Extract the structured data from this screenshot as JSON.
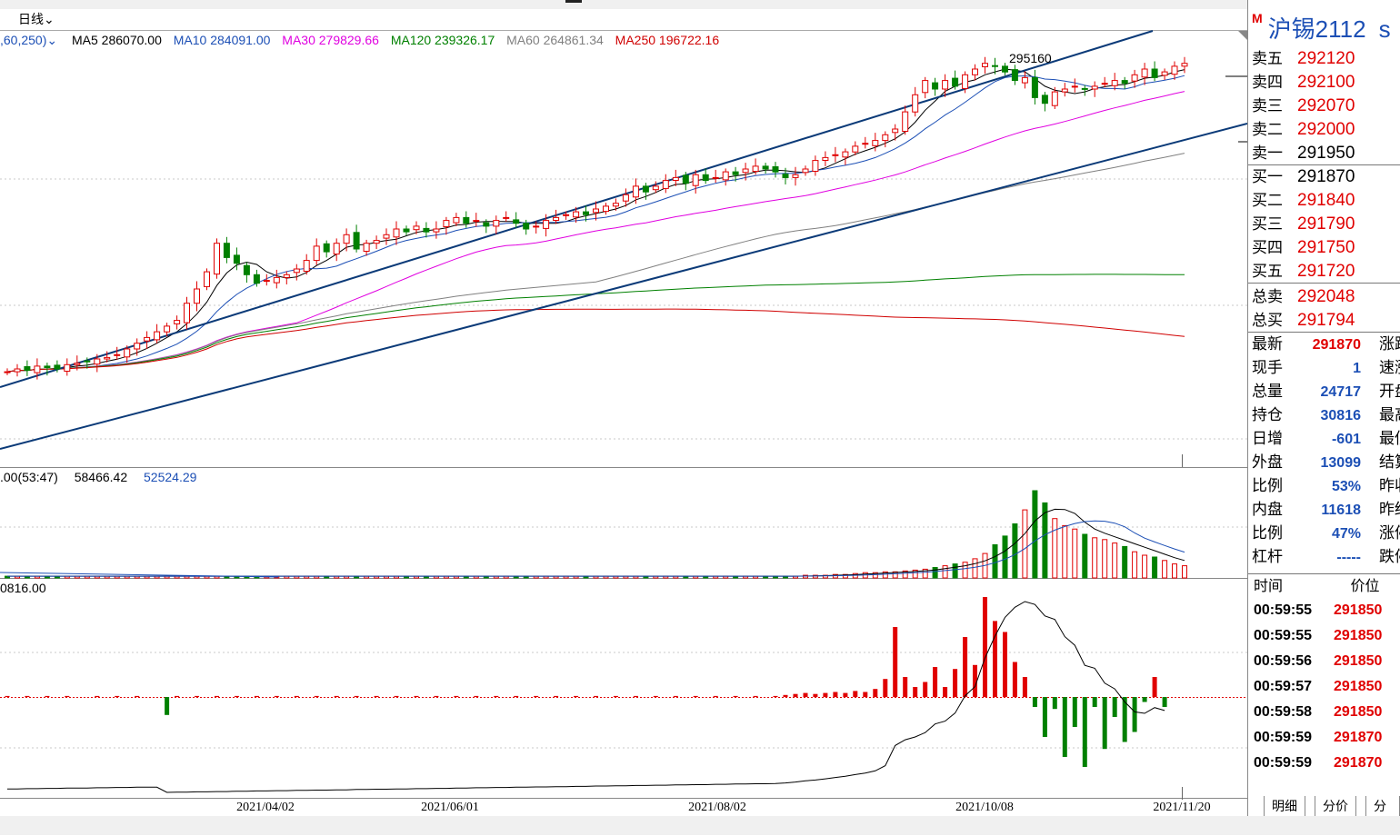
{
  "toolbar": {
    "period_label": "日线"
  },
  "ma_legend": [
    {
      "text": ",60,250)",
      "color": "#1c4fb5"
    },
    {
      "text": "MA5 286070.00",
      "color": "#000000"
    },
    {
      "text": "MA10 284091.00",
      "color": "#1c4fb5"
    },
    {
      "text": "MA30 279829.66",
      "color": "#e000e0"
    },
    {
      "text": "MA120 239326.17",
      "color": "#008000"
    },
    {
      "text": "MA60 264861.34",
      "color": "#808080"
    },
    {
      "text": "MA250 196722.16",
      "color": "#d00000"
    }
  ],
  "chart": {
    "high_label": "295160"
  },
  "vol_legend": [
    {
      "text": ".00(53:47)",
      "color": "#000000"
    },
    {
      "text": "58466.42",
      "color": "#000000"
    },
    {
      "text": "52524.29",
      "color": "#1c4fb5"
    }
  ],
  "oi_legend": {
    "text": "0816.00"
  },
  "dates": [
    "2021/04/02",
    "2021/06/01",
    "2021/08/02",
    "2021/10/08",
    "2021/11/20"
  ],
  "panel": {
    "marker": "M",
    "title": "沪锡2112",
    "title_tail": "s",
    "asks": [
      {
        "label": "卖五",
        "price": "292120"
      },
      {
        "label": "卖四",
        "price": "292100"
      },
      {
        "label": "卖三",
        "price": "292070"
      },
      {
        "label": "卖二",
        "price": "292000"
      },
      {
        "label": "卖一",
        "price": "291950"
      }
    ],
    "bids": [
      {
        "label": "买一",
        "price": "291870"
      },
      {
        "label": "买二",
        "price": "291840"
      },
      {
        "label": "买三",
        "price": "291790"
      },
      {
        "label": "买四",
        "price": "291750"
      },
      {
        "label": "买五",
        "price": "291720"
      }
    ],
    "totals": [
      {
        "label": "总卖",
        "value": "292048"
      },
      {
        "label": "总买",
        "value": "291794"
      }
    ],
    "stats": [
      {
        "label": "最新",
        "value": "291870",
        "red": true,
        "label2": "涨跌"
      },
      {
        "label": "现手",
        "value": "1",
        "red": false,
        "label2": "速涨"
      },
      {
        "label": "总量",
        "value": "24717",
        "red": false,
        "label2": "开盘"
      },
      {
        "label": "持仓",
        "value": "30816",
        "red": false,
        "label2": "最高"
      },
      {
        "label": "日增",
        "value": "-601",
        "red": false,
        "label2": "最低"
      },
      {
        "label": "外盘",
        "value": "13099",
        "red": false,
        "label2": "结算"
      },
      {
        "label": "比例",
        "value": "53%",
        "red": false,
        "label2": "昨收"
      },
      {
        "label": "内盘",
        "value": "11618",
        "red": false,
        "label2": "昨结"
      },
      {
        "label": "比例",
        "value": "47%",
        "red": false,
        "label2": "涨停"
      },
      {
        "label": "杠杆",
        "value": "-----",
        "red": false,
        "label2": "跌停"
      }
    ],
    "ticks_header": {
      "time": "时间",
      "price": "价位"
    },
    "ticks": [
      {
        "time": "00:59:55",
        "price": "291850"
      },
      {
        "time": "00:59:55",
        "price": "291850"
      },
      {
        "time": "00:59:56",
        "price": "291850"
      },
      {
        "time": "00:59:57",
        "price": "291850"
      },
      {
        "time": "00:59:58",
        "price": "291850"
      },
      {
        "time": "00:59:59",
        "price": "291870"
      },
      {
        "time": "00:59:59",
        "price": "291870"
      }
    ],
    "tabs": [
      "明细",
      "分价",
      "分笔"
    ]
  },
  "colors": {
    "up": "#e00000",
    "down": "#008000",
    "trend": "#0b3a78",
    "accent": "#1c4fb5"
  },
  "chart_data": {
    "type": "candlestick",
    "ylim": [
      160000,
      300000
    ],
    "candles_close": [
      187000,
      188000,
      187500,
      189000,
      188500,
      188000,
      189500,
      190000,
      190500,
      191500,
      192000,
      193000,
      195000,
      197000,
      199000,
      201000,
      203000,
      205000,
      211000,
      216000,
      222000,
      232000,
      227000,
      225000,
      221000,
      218000,
      219000,
      220000,
      221000,
      223000,
      226000,
      231000,
      229000,
      232000,
      235000,
      230000,
      232000,
      233000,
      235000,
      237000,
      236000,
      238000,
      236000,
      237000,
      240000,
      241000,
      239000,
      240000,
      238000,
      240000,
      241000,
      239000,
      237000,
      238000,
      240000,
      241000,
      242000,
      243000,
      242000,
      244000,
      245000,
      246000,
      249000,
      252000,
      250000,
      252000,
      254000,
      255000,
      253000,
      256000,
      254000,
      255000,
      257000,
      256000,
      258000,
      259000,
      258000,
      257000,
      255000,
      256000,
      258000,
      261000,
      262000,
      263000,
      264000,
      266000,
      267000,
      268000,
      270000,
      272000,
      278000,
      284000,
      289000,
      286000,
      289000,
      287000,
      291000,
      293000,
      295000,
      294000,
      292000,
      289000,
      290000,
      283000,
      281000,
      285000,
      286000,
      287000,
      286000,
      287000,
      288000,
      289000,
      288000,
      291000,
      293000,
      290000,
      292000,
      294000,
      295000
    ],
    "ma_series": [
      {
        "name": "MA5",
        "color": "#000000"
      },
      {
        "name": "MA10",
        "color": "#1c4fb5"
      },
      {
        "name": "MA30",
        "color": "#e000e0"
      },
      {
        "name": "MA60",
        "color": "#808080"
      },
      {
        "name": "MA120",
        "color": "#008000"
      },
      {
        "name": "MA250",
        "color": "#d00000"
      }
    ],
    "volume": [
      2,
      2,
      2,
      2,
      2,
      2,
      2,
      2,
      2,
      2,
      2,
      2,
      2,
      2,
      2,
      2,
      2,
      2,
      2,
      2,
      2,
      2,
      2,
      2,
      2,
      2,
      2,
      2,
      2,
      2,
      2,
      2,
      2,
      2,
      2,
      2,
      2,
      2,
      2,
      2,
      2,
      2,
      2,
      2,
      2,
      2,
      2,
      2,
      2,
      2,
      2,
      2,
      2,
      2,
      2,
      2,
      2,
      2,
      2,
      2,
      2,
      2,
      2,
      2,
      2,
      2,
      2,
      2,
      2,
      2,
      2,
      2,
      2,
      2,
      2,
      2,
      2,
      2,
      2,
      2,
      3,
      3,
      3,
      4,
      4,
      5,
      6,
      6,
      7,
      7,
      8,
      9,
      10,
      12,
      14,
      16,
      18,
      22,
      28,
      38,
      48,
      62,
      78,
      100,
      86,
      68,
      60,
      56,
      50,
      46,
      44,
      40,
      36,
      30,
      26,
      24,
      20,
      16,
      14
    ],
    "oi_change": [
      1,
      0,
      1,
      0,
      1,
      0,
      1,
      0,
      0,
      1,
      0,
      1,
      0,
      1,
      0,
      0,
      -18,
      1,
      0,
      1,
      0,
      1,
      0,
      1,
      0,
      1,
      0,
      1,
      0,
      1,
      0,
      1,
      0,
      1,
      0,
      1,
      0,
      1,
      0,
      1,
      0,
      1,
      0,
      1,
      0,
      1,
      0,
      1,
      0,
      1,
      0,
      1,
      0,
      1,
      0,
      1,
      0,
      1,
      0,
      1,
      0,
      1,
      0,
      1,
      0,
      1,
      0,
      1,
      0,
      1,
      0,
      1,
      0,
      1,
      0,
      1,
      0,
      1,
      2,
      3,
      4,
      3,
      4,
      5,
      4,
      6,
      5,
      8,
      18,
      70,
      20,
      10,
      15,
      30,
      10,
      28,
      60,
      32,
      100,
      76,
      65,
      35,
      20,
      -10,
      -40,
      -12,
      -60,
      -30,
      -70,
      -10,
      -52,
      -20,
      -45,
      -35,
      -5,
      20,
      -10
    ]
  }
}
